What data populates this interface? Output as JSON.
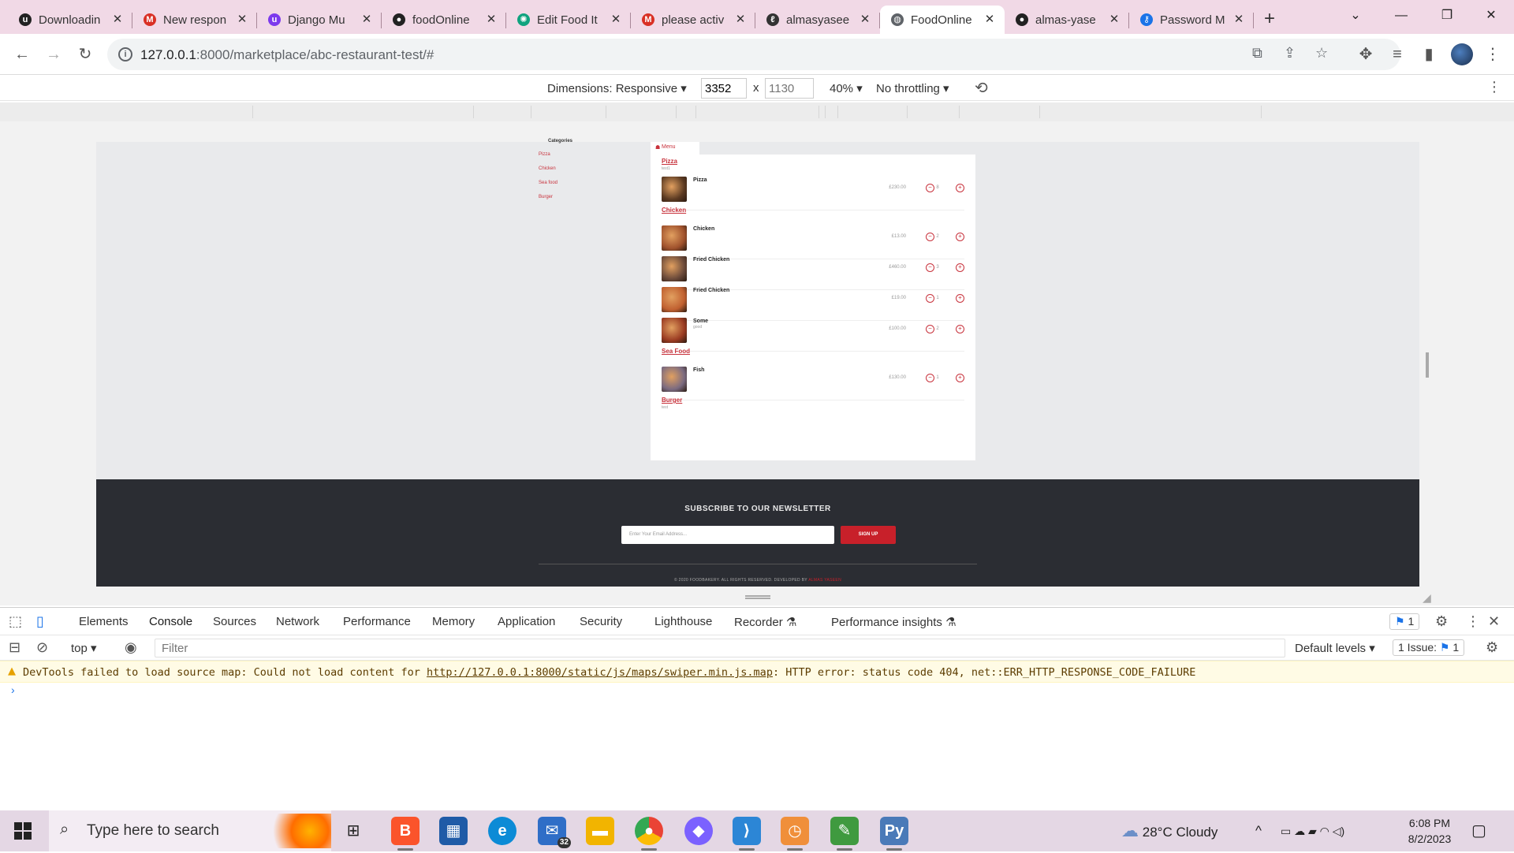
{
  "browser": {
    "tabs": [
      {
        "title": "Downloadin",
        "fav_color": "#222222",
        "fav_glyph": "u",
        "active": false
      },
      {
        "title": "New respon",
        "fav_color": "#d93025",
        "fav_glyph": "M",
        "active": false
      },
      {
        "title": "Django Mu",
        "fav_color": "#7c3aed",
        "fav_glyph": "u",
        "active": false
      },
      {
        "title": "foodOnline",
        "fav_color": "#222222",
        "fav_glyph": "●",
        "active": false
      },
      {
        "title": "Edit Food It",
        "fav_color": "#10a37f",
        "fav_glyph": "✺",
        "active": false
      },
      {
        "title": "please activ",
        "fav_color": "#d93025",
        "fav_glyph": "M",
        "active": false
      },
      {
        "title": "almasyasee",
        "fav_color": "#333333",
        "fav_glyph": "ℓ",
        "active": false
      },
      {
        "title": "FoodOnline",
        "fav_color": "#5f6368",
        "fav_glyph": "◍",
        "active": true
      },
      {
        "title": "almas-yase",
        "fav_color": "#222222",
        "fav_glyph": "●",
        "active": false
      },
      {
        "title": "Password M",
        "fav_color": "#1a73e8",
        "fav_glyph": "⚷",
        "active": false
      }
    ],
    "url_host": "127.0.0.1",
    "url_path": ":8000/marketplace/abc-restaurant-test/#"
  },
  "device_toolbar": {
    "dimensions_label": "Dimensions: Responsive ▾",
    "width_value": "3352",
    "times": "x",
    "height_placeholder": "1130",
    "zoom": "40% ▾",
    "throttling": "No throttling ▾"
  },
  "page": {
    "categories_heading": "Categories",
    "categories": [
      "Pizza",
      "Chicken",
      "Sea food",
      "Burger"
    ],
    "menu_tab_label": "Menu",
    "sections": [
      {
        "title": "Pizza",
        "description": "test1",
        "items": [
          {
            "name": "Pizza",
            "sub": "",
            "price": "£230.00",
            "qty": "8"
          }
        ]
      },
      {
        "title": "Chicken",
        "description": "",
        "items": [
          {
            "name": "Chicken",
            "sub": "",
            "price": "£13.00",
            "qty": "2"
          },
          {
            "name": "Fried Chicken",
            "sub": "",
            "price": "£460.00",
            "qty": "3"
          },
          {
            "name": "Fried Chicken",
            "sub": "",
            "price": "£19.00",
            "qty": "1"
          },
          {
            "name": "Some",
            "sub": "good",
            "price": "£100.00",
            "qty": "2"
          }
        ]
      },
      {
        "title": "Sea Food",
        "description": "",
        "items": [
          {
            "name": "Fish",
            "sub": "",
            "price": "£130.00",
            "qty": "1"
          }
        ]
      },
      {
        "title": "Burger",
        "description": "test",
        "items": []
      }
    ],
    "newsletter_title": "SUBSCRIBE TO OUR NEWSLETTER",
    "email_placeholder": "Enter Your Email Address...",
    "signup_label": "SIGN UP",
    "copyright": "© 2020 FOODBAKERY. ALL RIGHTS RESERVED. DEVELOPED BY",
    "developer": "ALMAS YASEEN"
  },
  "devtools": {
    "tabs": [
      "Elements",
      "Console",
      "Sources",
      "Network",
      "Performance",
      "Memory",
      "Application",
      "Security",
      "Lighthouse",
      "Recorder ⚗",
      "Performance insights ⚗"
    ],
    "active_tab": "Console",
    "issues_badge": "1",
    "context": "top",
    "filter_placeholder": "Filter",
    "levels": "Default levels ▾",
    "issue_count_label": "1 Issue:",
    "issue_count": "1",
    "warning_prefix": "DevTools failed to load source map: Could not load content for ",
    "warning_link": "http://127.0.0.1:8000/static/js/maps/swiper.min.js.map",
    "warning_suffix": ": HTTP error: status code 404, net::ERR_HTTP_RESPONSE_CODE_FAILURE"
  },
  "taskbar": {
    "search_placeholder": "Type here to search",
    "mail_badge": "32",
    "weather": "28°C  Cloudy",
    "time": "6:08 PM",
    "date": "8/2/2023"
  }
}
